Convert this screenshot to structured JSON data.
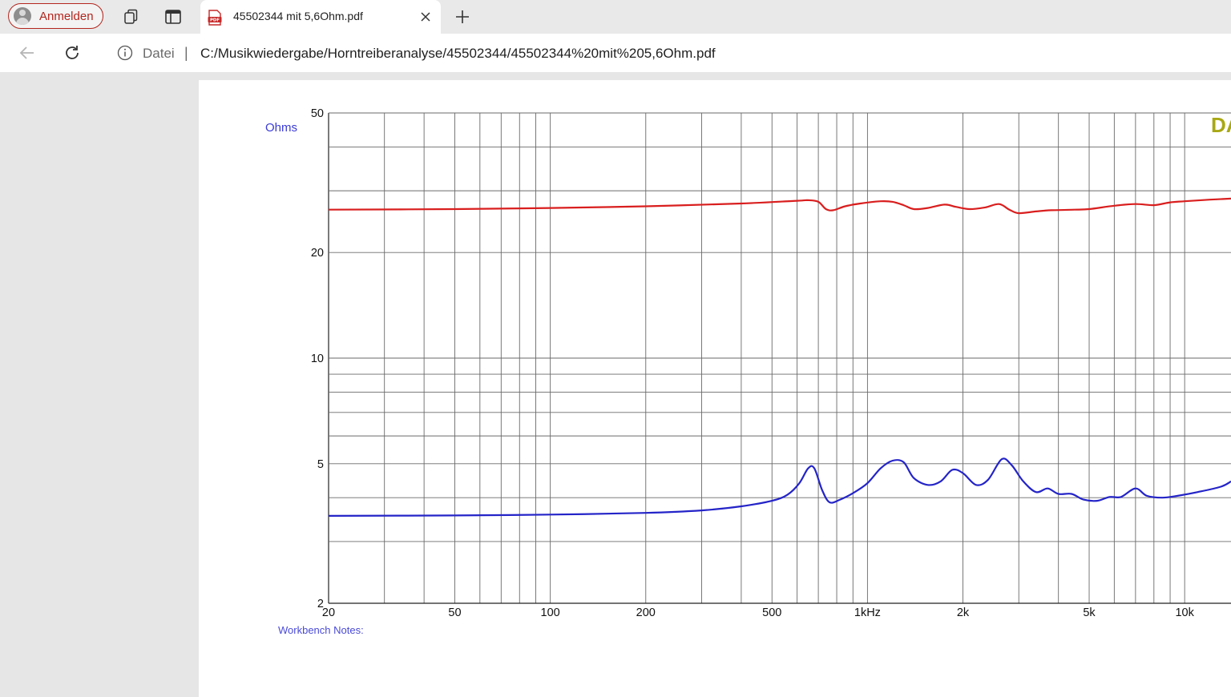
{
  "tabbar": {
    "profile_label": "Anmelden",
    "active_tab_title": "45502344 mit 5,6Ohm.pdf"
  },
  "addressbar": {
    "scheme_label": "Datei",
    "separator": "|",
    "url": "C:/Musikwiedergabe/Horntreiberanalyse/45502344/45502344%20mit%205,6Ohm.pdf"
  },
  "document": {
    "notes_label": "Workbench Notes:",
    "corner_text": "DA"
  },
  "colors": {
    "profile_accent": "#b3261e",
    "impedance_curve": "#2424c8",
    "upper_curve": "#d91e1e",
    "axis_label": "#3a3ad8"
  },
  "chart_data": {
    "type": "line",
    "x_scale": "log",
    "y_scale": "log",
    "xlim": [
      20,
      14000
    ],
    "ylim": [
      2,
      50
    ],
    "ylabel": "Ohms",
    "grid": true,
    "x_tick_labels": [
      {
        "value": 20,
        "label": "20"
      },
      {
        "value": 50,
        "label": "50"
      },
      {
        "value": 100,
        "label": "100"
      },
      {
        "value": 200,
        "label": "200"
      },
      {
        "value": 500,
        "label": "500"
      },
      {
        "value": 1000,
        "label": "1kHz"
      },
      {
        "value": 2000,
        "label": "2k"
      },
      {
        "value": 5000,
        "label": "5k"
      },
      {
        "value": 10000,
        "label": "10k"
      }
    ],
    "y_tick_labels": [
      {
        "value": 50,
        "label": "50"
      },
      {
        "value": 20,
        "label": "20"
      },
      {
        "value": 10,
        "label": "10"
      },
      {
        "value": 5,
        "label": "5"
      },
      {
        "value": 2,
        "label": "2"
      }
    ],
    "x_grid": [
      20,
      30,
      40,
      50,
      60,
      70,
      80,
      90,
      100,
      200,
      300,
      400,
      500,
      600,
      700,
      800,
      900,
      1000,
      2000,
      3000,
      4000,
      5000,
      6000,
      7000,
      8000,
      9000,
      10000
    ],
    "y_grid": [
      2,
      3,
      4,
      5,
      6,
      7,
      8,
      9,
      10,
      20,
      30,
      40,
      50
    ],
    "series": [
      {
        "color": "#d91e1e",
        "points": [
          [
            20,
            26.5
          ],
          [
            50,
            26.6
          ],
          [
            100,
            26.8
          ],
          [
            200,
            27.1
          ],
          [
            400,
            27.6
          ],
          [
            600,
            28.1
          ],
          [
            650,
            28.2
          ],
          [
            700,
            27.9
          ],
          [
            740,
            26.6
          ],
          [
            780,
            26.4
          ],
          [
            850,
            27.1
          ],
          [
            950,
            27.6
          ],
          [
            1100,
            28.0
          ],
          [
            1200,
            27.9
          ],
          [
            1300,
            27.3
          ],
          [
            1400,
            26.6
          ],
          [
            1550,
            26.8
          ],
          [
            1750,
            27.4
          ],
          [
            1900,
            27.0
          ],
          [
            2100,
            26.6
          ],
          [
            2350,
            26.9
          ],
          [
            2600,
            27.5
          ],
          [
            2800,
            26.5
          ],
          [
            3000,
            25.9
          ],
          [
            3400,
            26.2
          ],
          [
            3800,
            26.4
          ],
          [
            4500,
            26.5
          ],
          [
            5000,
            26.6
          ],
          [
            6000,
            27.2
          ],
          [
            7000,
            27.5
          ],
          [
            8000,
            27.3
          ],
          [
            9000,
            27.8
          ],
          [
            10000,
            28.0
          ],
          [
            12000,
            28.3
          ],
          [
            14000,
            28.5
          ]
        ]
      },
      {
        "color": "#2424c8",
        "points": [
          [
            20,
            3.55
          ],
          [
            50,
            3.56
          ],
          [
            100,
            3.58
          ],
          [
            200,
            3.62
          ],
          [
            300,
            3.68
          ],
          [
            400,
            3.78
          ],
          [
            500,
            3.92
          ],
          [
            560,
            4.08
          ],
          [
            610,
            4.4
          ],
          [
            650,
            4.85
          ],
          [
            680,
            4.85
          ],
          [
            720,
            4.2
          ],
          [
            760,
            3.88
          ],
          [
            820,
            3.95
          ],
          [
            900,
            4.12
          ],
          [
            1000,
            4.4
          ],
          [
            1100,
            4.85
          ],
          [
            1200,
            5.1
          ],
          [
            1300,
            5.05
          ],
          [
            1400,
            4.55
          ],
          [
            1550,
            4.35
          ],
          [
            1700,
            4.45
          ],
          [
            1850,
            4.8
          ],
          [
            2000,
            4.7
          ],
          [
            2200,
            4.35
          ],
          [
            2400,
            4.5
          ],
          [
            2650,
            5.15
          ],
          [
            2850,
            4.95
          ],
          [
            3100,
            4.45
          ],
          [
            3400,
            4.15
          ],
          [
            3700,
            4.25
          ],
          [
            4000,
            4.1
          ],
          [
            4400,
            4.1
          ],
          [
            4800,
            3.95
          ],
          [
            5300,
            3.92
          ],
          [
            5800,
            4.02
          ],
          [
            6300,
            4.02
          ],
          [
            7000,
            4.25
          ],
          [
            7600,
            4.05
          ],
          [
            8500,
            4.0
          ],
          [
            9500,
            4.05
          ],
          [
            11000,
            4.15
          ],
          [
            13000,
            4.3
          ],
          [
            14000,
            4.45
          ]
        ]
      }
    ]
  }
}
